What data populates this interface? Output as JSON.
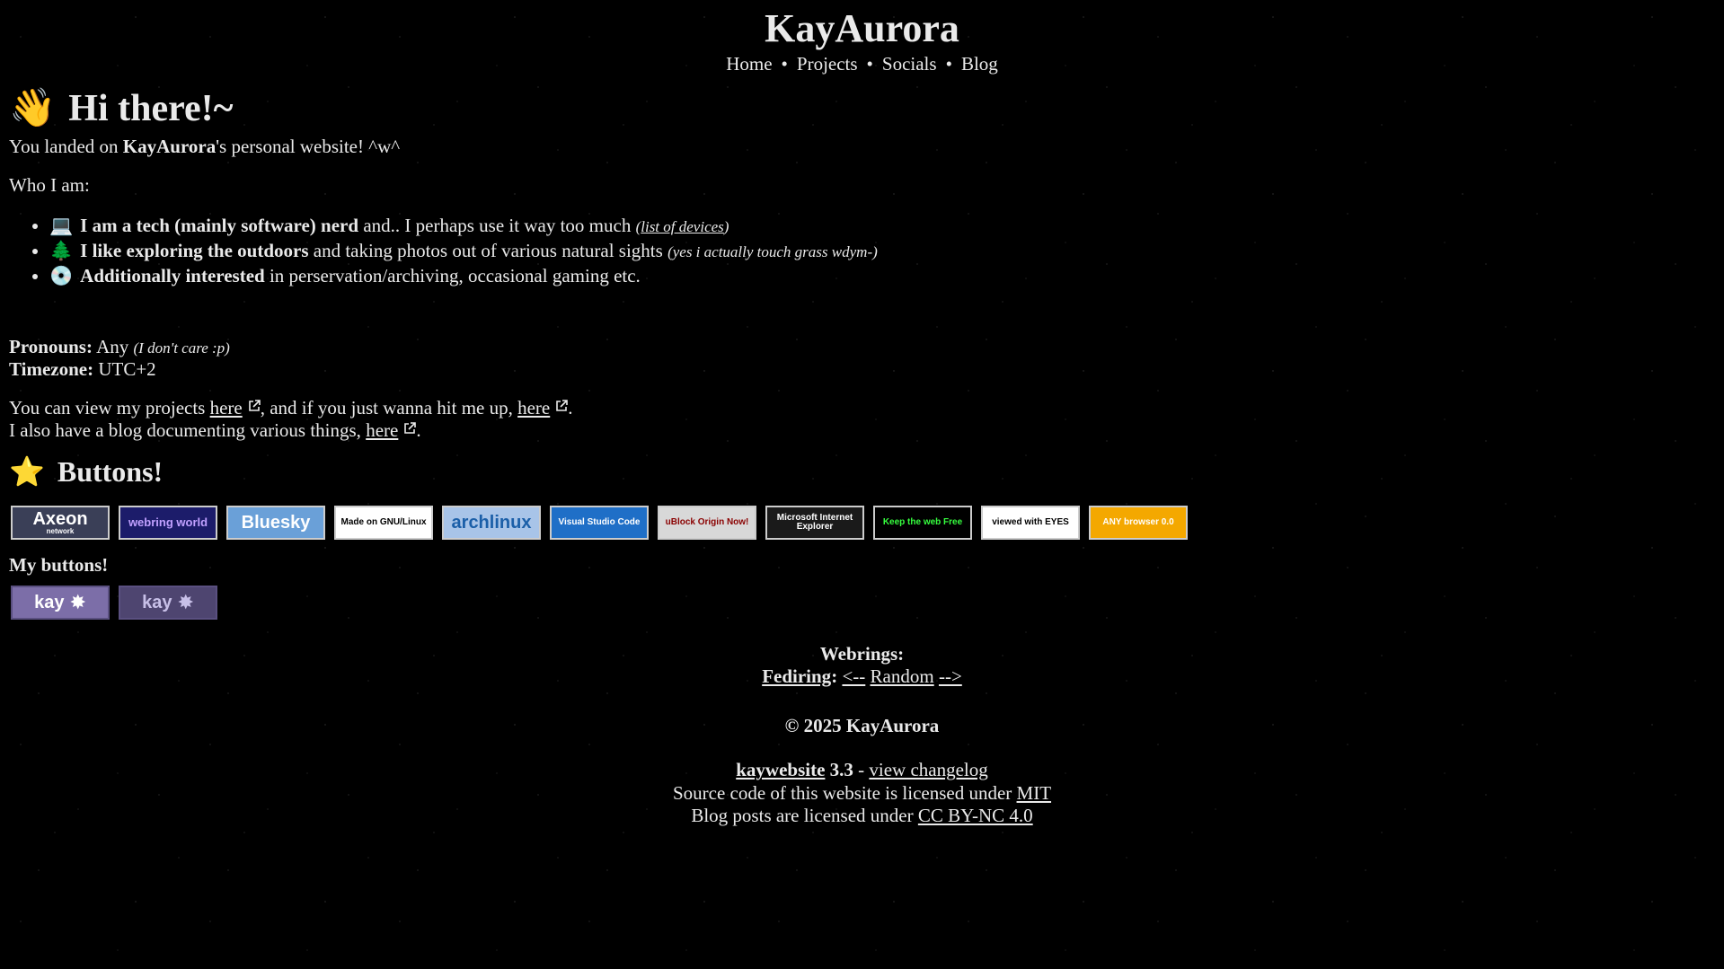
{
  "header": {
    "title": "KayAurora",
    "nav": [
      "Home",
      "Projects",
      "Socials",
      "Blog"
    ],
    "nav_separator": "•"
  },
  "intro": {
    "heading_emoji": "👋",
    "heading": "Hi there!~",
    "landed_pre": "You landed on ",
    "landed_name": "KayAurora",
    "landed_post": "'s personal website! ^w^",
    "who_label": "Who I am:"
  },
  "who_items": [
    {
      "emoji": "💻",
      "bold": "I am a tech (mainly software) nerd",
      "text": " and.. I perhaps use it way too much ",
      "aside_open": "(",
      "aside_link": "list of devices",
      "aside_close": ")"
    },
    {
      "emoji": "🌲",
      "bold": "I like exploring the outdoors",
      "text": " and taking photos out of various natural sights ",
      "aside": "(yes i actually touch grass wdym-)"
    },
    {
      "emoji": "💿",
      "bold": "Additionally interested",
      "text": " in perservation/archiving, occasional gaming etc."
    }
  ],
  "details": {
    "pronouns_label": "Pronouns:",
    "pronouns_value": " Any ",
    "pronouns_note": "(I don't care :p)",
    "timezone_label": "Timezone:",
    "timezone_value": " UTC+2"
  },
  "links": {
    "projects_pre": "You can view my projects ",
    "here": "here",
    "contact_mid": ", and if you just wanna hit me up, ",
    "period": ".",
    "blog_pre": "I also have a blog documenting various things, "
  },
  "buttons_section": {
    "emoji": "⭐",
    "heading": "Buttons!",
    "badges": [
      {
        "label": "Axeon",
        "sub": "network",
        "icon": "axeon-logo",
        "bg": "#3a3f57",
        "fg": "#ffffff"
      },
      {
        "label": "webring world",
        "icon": "webring-world",
        "bg": "#1c1c6a",
        "fg": "#c0a0ff"
      },
      {
        "label": "Bluesky",
        "icon": "bluesky-butterfly",
        "bg": "#6aa0d8",
        "fg": "#ffffff"
      },
      {
        "label": "Made on GNU/Linux",
        "icon": "tux-penguin",
        "bg": "#ffffff",
        "fg": "#000000"
      },
      {
        "label": "archlinux",
        "icon": "arch-logo",
        "bg": "#a8c4e8",
        "fg": "#1b5fa8"
      },
      {
        "label": "Visual Studio Code",
        "icon": "vscode-logo",
        "bg": "#1f6fc7",
        "fg": "#ffffff"
      },
      {
        "label": "uBlock Origin Now!",
        "icon": "ublock-shield",
        "bg": "#d8d8d8",
        "fg": "#8a0000"
      },
      {
        "label": "Microsoft Internet Explorer",
        "icon": "ie-logo",
        "bg": "#1a1a1a",
        "fg": "#ffffff"
      },
      {
        "label": "Keep the web Free",
        "icon": "keep-web-free",
        "bg": "#000000",
        "fg": "#36ff3f"
      },
      {
        "label": "viewed with EYES",
        "icon": "eyes",
        "bg": "#ffffff",
        "fg": "#000000"
      },
      {
        "label": "ANY browser 0.0",
        "icon": "checkmark",
        "bg": "#f4a800",
        "fg": "#ffffff"
      }
    ],
    "my_buttons_label": "My buttons!",
    "my_buttons": [
      {
        "label": "kay",
        "icon": "star-burst",
        "bg": "#7c6ea8",
        "fg": "#ffffff"
      },
      {
        "label": "kay",
        "icon": "star-burst",
        "bg": "#4e4570",
        "fg": "#c8c0e8"
      }
    ]
  },
  "footer": {
    "webrings_label": "Webrings:",
    "fediring_label": "Fediring",
    "colon": ":",
    "prev": "<--",
    "random": "Random",
    "next": "-->",
    "copyright": "© 2025 KayAurora",
    "site_name": "kaywebsite",
    "version": " 3.3",
    "dash": " - ",
    "changelog": "view changelog",
    "source_license_pre": "Source code of this website is licensed under ",
    "source_license": "MIT",
    "blog_license_pre": "Blog posts are licensed under ",
    "blog_license": "CC BY-NC 4.0"
  }
}
